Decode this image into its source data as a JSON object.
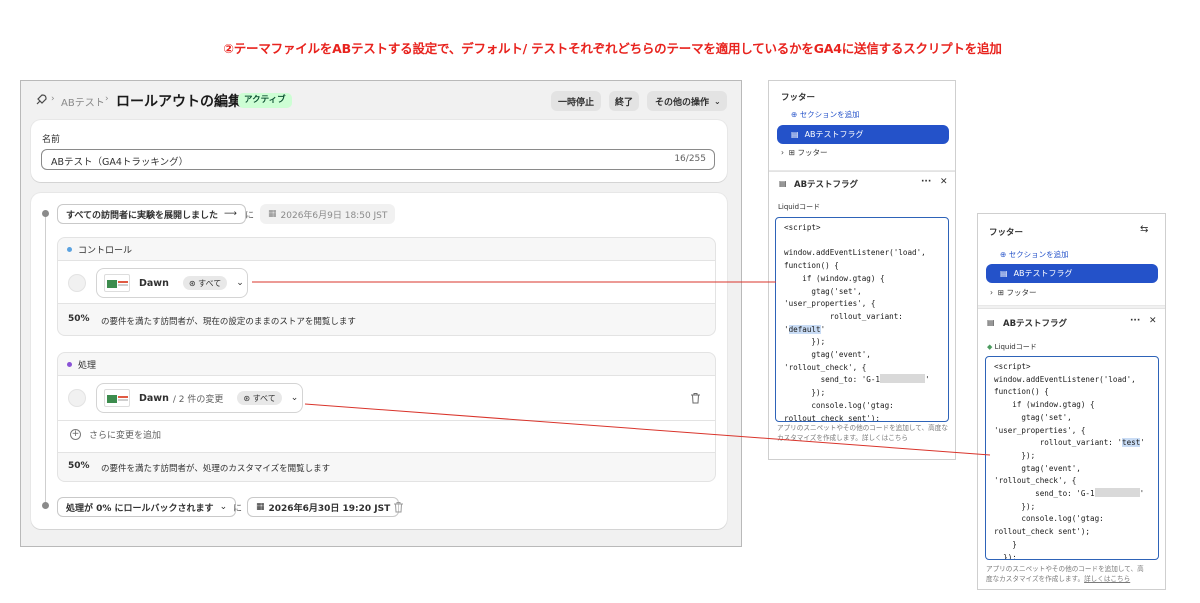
{
  "headline": "②テーマファイルをABテストする設定で、デフォルト/ テストそれぞれどちらのテーマを適用しているかをGA4に送信するスクリプトを追加",
  "admin": {
    "breadcrumb": {
      "parent": "ABテスト",
      "sep": "›",
      "title": "ロールアウトの編集",
      "status": "アクティブ"
    },
    "actions": {
      "pause": "一時停止",
      "end": "終了",
      "more": "その他の操作"
    },
    "name_field": {
      "label": "名前",
      "value": "ABテスト（GA4トラッキング）",
      "counter": "16/255"
    },
    "timeline": {
      "start_action": "すべての訪問者に実験を展開しました",
      "connector": "に",
      "start_date": "2026年6月9日 18:50 JST",
      "control": {
        "label": "コントロール",
        "theme": "Dawn",
        "scope": "すべて",
        "percent": "50%",
        "desc": "の要件を満たす訪問者が、現在の設定のままのストアを閲覧します"
      },
      "treatment": {
        "label": "処理",
        "theme": "Dawn",
        "changes": "/ 2 件の変更",
        "scope": "すべて",
        "add_change": "さらに変更を追加",
        "percent": "50%",
        "desc": "の要件を満たす訪問者が、処理のカスタマイズを閲覧します"
      },
      "rollback_action": "処理が 0% にロールバックされます",
      "end_connector": "に",
      "end_date": "2026年6月30日 19:20 JST"
    }
  },
  "panel_default": {
    "section_title": "フッター",
    "add_section": "セクションを追加",
    "selected_block": "ABテストフラグ",
    "footer_item": "フッター",
    "block_header": "ABテストフラグ",
    "code_label": "Liquidコード",
    "code_before": "<script>\n\nwindow.addEventListener('load',\nfunction() {\n    if (window.gtag) {\n      gtag('set',\n'user_properties', {\n          rollout_variant:\n'",
    "variant": "default",
    "code_after": "'\n      });\n      gtag('event',\n'rollout_check', {\n        send_to: 'G-1",
    "code_tail": "'\n      });\n      console.log('gtag:\nrollout_check sent');",
    "help": "アプリのスニペットやその他のコードを追加して、高度なカスタマイズを作成します。詳しくはこちら"
  },
  "panel_test": {
    "section_title": "フッター",
    "add_section": "セクションを追加",
    "selected_block": "ABテストフラグ",
    "footer_item": "フッター",
    "block_header": "ABテストフラグ",
    "code_label": "Liquidコード",
    "code_before": "<script>\nwindow.addEventListener('load',\nfunction() {\n    if (window.gtag) {\n      gtag('set',\n'user_properties', {\n          rollout_variant: '",
    "variant": "test",
    "code_after": "'\n      });\n      gtag('event',\n'rollout_check', {\n         send_to: 'G-1",
    "code_tail": "'\n      });\n      console.log('gtag:\nrollout_check sent');\n    }\n  });",
    "help_line1": "アプリのスニペットやその他のコードを追加して、高",
    "help_line2": "度なカスタマイズを作成します。",
    "help_link": "詳しくはこちら"
  },
  "colors": {
    "headline": "#e8231e",
    "accent": "#2452c9",
    "connector_line": "#d9342b",
    "status_badge": "#cdfed4"
  }
}
